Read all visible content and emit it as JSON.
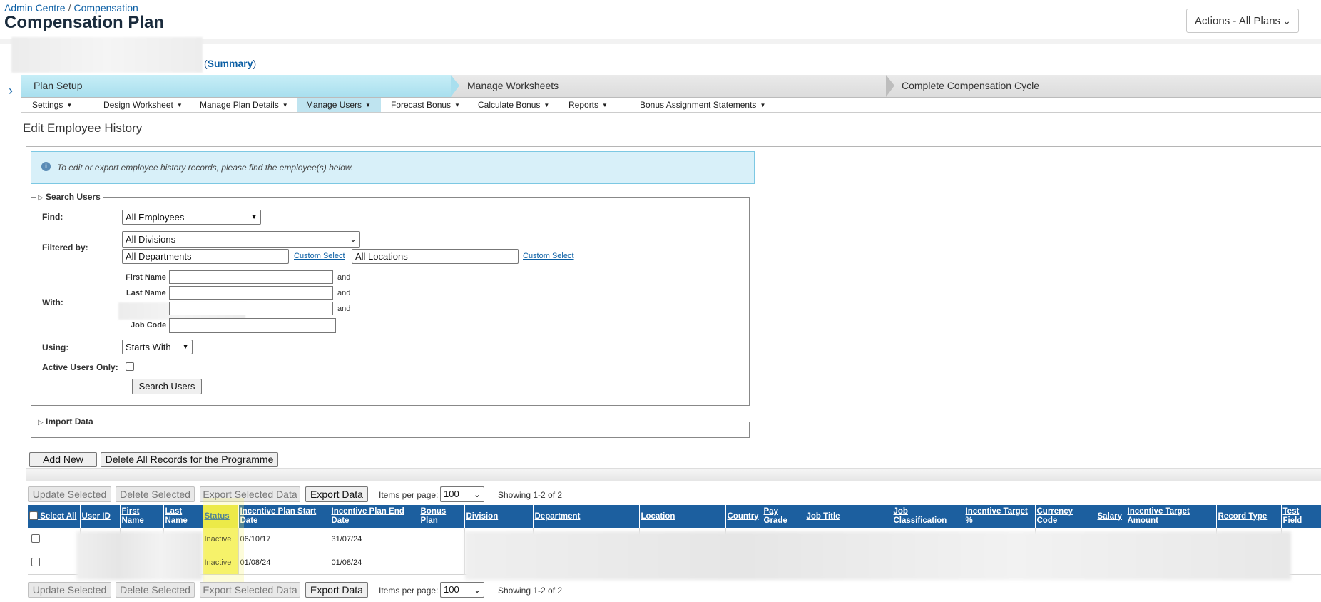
{
  "header": {
    "breadcrumb": [
      "Admin Centre",
      "/",
      "Compensation"
    ],
    "title": "Compensation Plan",
    "actions_label": "Actions - All Plans"
  },
  "plan": {
    "summary_link": "Summary",
    "open_paren": "(",
    "close_paren": ")"
  },
  "steps": [
    "Plan Setup",
    "Manage Worksheets",
    "Complete Compensation Cycle"
  ],
  "menu": [
    "Settings",
    "Design Worksheet",
    "Manage Plan Details",
    "Manage Users",
    "Forecast Bonus",
    "Calculate Bonus",
    "Reports",
    "Bonus Assignment Statements"
  ],
  "section_title": "Edit Employee History",
  "info_message": "To edit or export employee history records, please find the employee(s) below.",
  "search": {
    "legend": "Search Users",
    "find_label": "Find:",
    "find_value": "All Employees",
    "filtered_label": "Filtered by:",
    "division_value": "All Divisions",
    "department_value": "All Departments",
    "custom_select_1": "Custom Select",
    "location_value": "All Locations",
    "custom_select_2": "Custom Select",
    "with_label": "With:",
    "first_name_label": "First Name",
    "last_name_label": "Last Name",
    "job_code_label": "Job Code",
    "and": "and",
    "using_label": "Using:",
    "using_value": "Starts With",
    "active_only_label": "Active Users Only:",
    "search_button": "Search Users"
  },
  "import": {
    "legend": "Import Data"
  },
  "actions": {
    "add_new": "Add New",
    "delete_all": "Delete All Records for the Programme"
  },
  "toolbar": {
    "update_selected": "Update Selected",
    "delete_selected": "Delete Selected",
    "export_selected": "Export Selected Data",
    "export_data": "Export Data",
    "items_per_page_label": "Items per page:",
    "items_per_page_value": "100",
    "showing": "Showing 1-2 of 2"
  },
  "table": {
    "columns": [
      "Select All",
      "User ID",
      "First Name",
      "Last Name",
      "Status",
      "Incentive Plan Start Date",
      "Incentive Plan End Date",
      "Bonus Plan",
      "Division",
      "Department",
      "Location",
      "Country",
      "Pay Grade",
      "Job Title",
      "Job Classification",
      "Incentive Target %",
      "Currency Code",
      "Salary",
      "Incentive Target Amount",
      "Record Type",
      "Test Field"
    ],
    "rows": [
      {
        "status": "Inactive",
        "start": "06/10/17",
        "end": "31/07/24"
      },
      {
        "status": "Inactive",
        "start": "01/08/24",
        "end": "01/08/24"
      }
    ]
  },
  "colors": {
    "table_header": "#1c5f9f",
    "highlight": "#f6f26a",
    "step_active": "#a9dfee",
    "link": "#0b5fa5"
  }
}
